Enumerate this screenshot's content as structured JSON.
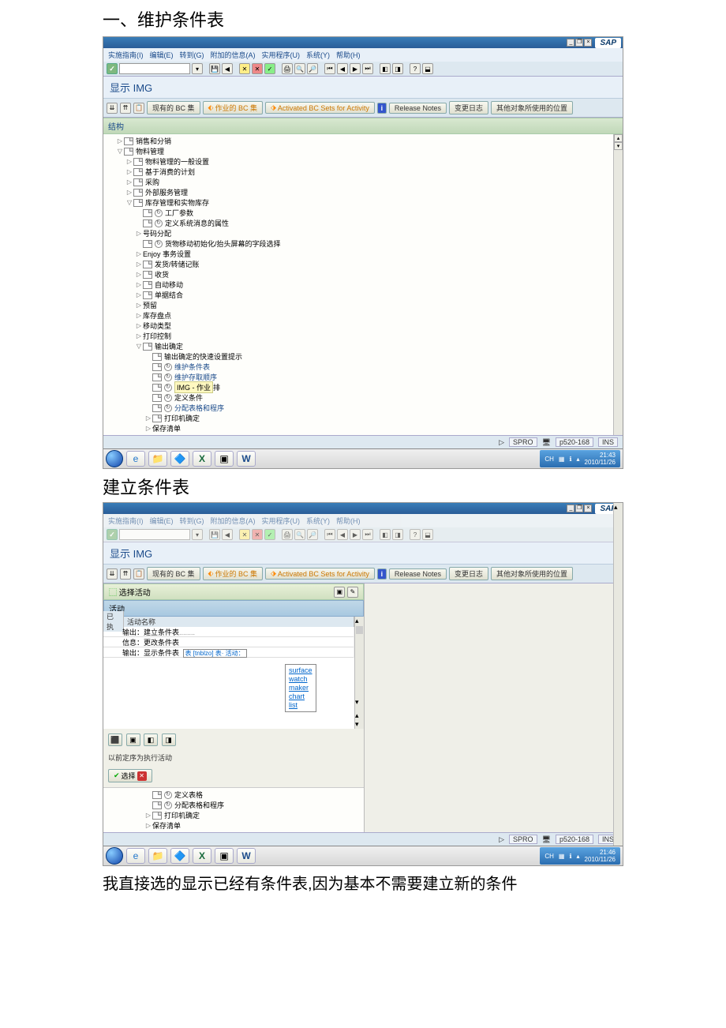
{
  "doc": {
    "heading1": "一、维护条件表",
    "heading2": "建立条件表",
    "paragraph": "我直接选的显示已经有条件表,因为基本不需要建立新的条件"
  },
  "sap": {
    "logo": "SAP",
    "menubar": [
      "实施指南(I)",
      "编辑(E)",
      "转到(G)",
      "附加的信息(A)",
      "实用程序(U)",
      "系统(Y)",
      "帮助(H)"
    ],
    "page_title": "显示 IMG",
    "toolbar2": {
      "bc_set_current": "现有的 BC 集",
      "bc_set_activity": "作业的 BC 集",
      "bc_sets_activated": "Activated BC Sets for Activity",
      "release_notes": "Release Notes",
      "change_log": "变更日志",
      "other_places": "其他对象所使用的位置"
    },
    "section_structure": "结构",
    "tree": [
      {
        "d": 1,
        "t": "▷",
        "i": "doc",
        "l": "销售和分销"
      },
      {
        "d": 1,
        "t": "▽",
        "i": "doc",
        "l": "物料管理"
      },
      {
        "d": 2,
        "t": "▷",
        "i": "doc",
        "l": "物料管理的一般设置"
      },
      {
        "d": 2,
        "t": "▷",
        "i": "doc",
        "l": "基于消费的计划"
      },
      {
        "d": 2,
        "t": "▷",
        "i": "doc",
        "l": "采购"
      },
      {
        "d": 2,
        "t": "▷",
        "i": "doc",
        "l": "外部服务管理"
      },
      {
        "d": 2,
        "t": "▽",
        "i": "doc",
        "l": "库存管理和实物库存"
      },
      {
        "d": 3,
        "t": "",
        "i": "doc",
        "i2": "clock",
        "l": "工厂参数"
      },
      {
        "d": 3,
        "t": "",
        "i": "doc",
        "i2": "clock",
        "l": "定义系统消息的属性"
      },
      {
        "d": 3,
        "t": "▷",
        "i": "",
        "l": "号码分配"
      },
      {
        "d": 3,
        "t": "",
        "i": "doc",
        "i2": "clock",
        "l": "货物移动初始化/抬头屏幕的字段选择"
      },
      {
        "d": 3,
        "t": "▷",
        "i": "",
        "l": "Enjoy 事务设置"
      },
      {
        "d": 3,
        "t": "▷",
        "i": "doc",
        "l": "发货/转储记账"
      },
      {
        "d": 3,
        "t": "▷",
        "i": "doc",
        "l": "收货"
      },
      {
        "d": 3,
        "t": "▷",
        "i": "doc",
        "l": "自动移动"
      },
      {
        "d": 3,
        "t": "▷",
        "i": "doc",
        "l": "单据结合"
      },
      {
        "d": 3,
        "t": "▷",
        "i": "",
        "l": "预留"
      },
      {
        "d": 3,
        "t": "▷",
        "i": "",
        "l": "库存盘点"
      },
      {
        "d": 3,
        "t": "▷",
        "i": "",
        "l": "移动类型"
      },
      {
        "d": 3,
        "t": "▷",
        "i": "",
        "l": "打印控制"
      },
      {
        "d": 3,
        "t": "▽",
        "i": "doc",
        "l": "输出确定"
      },
      {
        "d": 4,
        "t": "",
        "i": "doc",
        "l": "输出确定的快速设置提示"
      },
      {
        "d": 4,
        "t": "",
        "i": "doc",
        "i2": "clock",
        "l": "维护条件表",
        "link": true
      },
      {
        "d": 4,
        "t": "",
        "i": "doc",
        "i2": "clock",
        "l": "维护存取顺序",
        "link": true
      },
      {
        "d": 4,
        "t": "",
        "i": "doc",
        "i2": "clock",
        "l": "",
        "hl": "IMG - 作业",
        "hl2": "排"
      },
      {
        "d": 4,
        "t": "",
        "i": "doc",
        "i2": "clock",
        "l": "定义条件"
      },
      {
        "d": 4,
        "t": "",
        "i": "doc",
        "i2": "clock",
        "l": "分配表格和程序",
        "link": true
      },
      {
        "d": 4,
        "t": "▷",
        "i": "doc",
        "l": "打印机确定"
      },
      {
        "d": 4,
        "t": "▷",
        "i": "",
        "l": "保存清单"
      }
    ],
    "status": {
      "tcode": "SPRO",
      "server": "p520-168",
      "ovr": "INS"
    }
  },
  "sap2": {
    "panel_select": "选择活动",
    "panel_activity": "活动",
    "grid_header_exec": "已执",
    "grid_header_name": "活动名称",
    "grid_rows": [
      "输出：建立条件表",
      "信息：更改条件表",
      "输出：显示条件表"
    ],
    "tool_hint": "表 [tnblzo] 表· 活动：",
    "suggestions": [
      "surface",
      "watch",
      "maker",
      "chart",
      "list"
    ],
    "below_text": "以前定序为执行活动",
    "choose": "选择",
    "bottom_tree": [
      {
        "d": 4,
        "t": "",
        "i": "doc",
        "i2": "clock",
        "l": "定义表格"
      },
      {
        "d": 4,
        "t": "",
        "i": "doc",
        "i2": "clock",
        "l": "分配表格和程序"
      },
      {
        "d": 4,
        "t": "▷",
        "i": "doc",
        "l": "打印机确定"
      },
      {
        "d": 4,
        "t": "▷",
        "i": "",
        "l": "保存清单"
      }
    ]
  },
  "taskbar": {
    "time": "21:43",
    "date": "2010/11/26",
    "time2": "21:46",
    "lang": "CH"
  }
}
